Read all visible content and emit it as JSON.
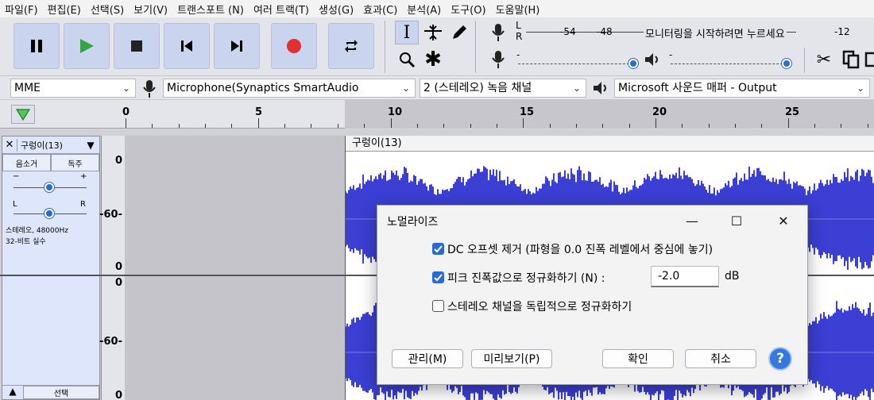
{
  "menu": [
    "파일(F)",
    "편집(E)",
    "선택(S)",
    "보기(V)",
    "트랜스포트 (N)",
    "여러 트랙(T)",
    "생성(G)",
    "효과(C)",
    "분석(A)",
    "도구(O)",
    "도움말(H)"
  ],
  "meter": {
    "ch_left": "L",
    "ch_right": "R",
    "ticks": [
      "-54",
      "-48",
      "-12"
    ],
    "prompt": "모니터링을 시작하려면 누르세요"
  },
  "devices": {
    "host": "MME",
    "input": "Microphone(Synaptics SmartAudio",
    "channels": "2 (스테레오) 녹음 채널",
    "output": "Microsoft 사운드 매퍼 - Output"
  },
  "ruler": {
    "labels": [
      {
        "t": 0,
        "text": "0"
      },
      {
        "t": 5,
        "text": "5"
      },
      {
        "t": 10,
        "text": "10"
      },
      {
        "t": 15,
        "text": "15"
      },
      {
        "t": 20,
        "text": "20"
      },
      {
        "t": 25,
        "text": "25"
      }
    ]
  },
  "track": {
    "name": "구렁이(13)",
    "mute": "음소거",
    "solo": "독주",
    "gain_minus": "−",
    "gain_plus": "+",
    "pan_left": "L",
    "pan_right": "R",
    "info1": "스테레오, 48000Hz",
    "info2": "32-비트 실수",
    "select": "선택",
    "scale": [
      "0",
      "-60-",
      "0",
      "0",
      "-60-",
      "0"
    ],
    "clip_name": "구렁이(13)"
  },
  "dialog": {
    "title": "노멀라이즈",
    "opt_dc": "DC 오프셋 제거 (파형을 0.0 진폭 레벨에서 중심에 놓기)",
    "opt_peak": "피크 진폭값으로 정규화하기 (N) :",
    "peak_value": "-2.0",
    "peak_unit": "dB",
    "opt_stereo": "스테레오 채널을 독립적으로 정규화하기",
    "btn_manage": "관리(M)",
    "btn_preview": "미리보기(P)",
    "btn_ok": "확인",
    "btn_cancel": "취소",
    "help": "?"
  },
  "colors": {
    "waveform": "#3b3fd3",
    "transport_btn": "#cbd4ee",
    "accent": "#2a6bd0",
    "record": "#e03030",
    "play": "#2eaa3a"
  }
}
